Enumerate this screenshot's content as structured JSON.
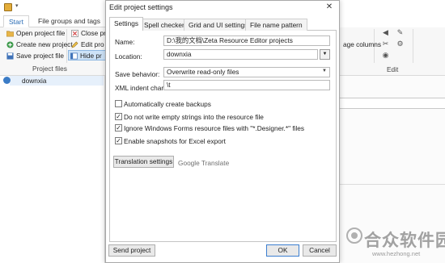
{
  "main_window": {
    "ribbon_tabs": [
      "Start",
      "File groups and tags"
    ],
    "qat_dropdown": "▾",
    "buttons": {
      "open_project_file": "Open project file",
      "create_new_project": "Create new project",
      "save_project_file": "Save project file",
      "close_project": "Close pr",
      "edit_project": "Edit pro",
      "hide_project": "Hide pr"
    },
    "group_label": "Project files",
    "tree_item": "downxia",
    "right_ribbon": {
      "columns_text": "age columns",
      "edit_group": "Edit"
    }
  },
  "dialog": {
    "title": "Edit project settings",
    "close_glyph": "✕",
    "tabs": [
      "Settings",
      "Spell checker",
      "Grid and UI settings",
      "File name pattern"
    ],
    "name_label": "Name:",
    "name_value": "D:\\我的文档\\Zeta Resource Editor projects",
    "location_label": "Location:",
    "location_value": "downxia",
    "location_btn": "▼",
    "save_behavior_label": "Save behavior:",
    "save_behavior_value": "Overwrite read-only files",
    "save_caret": "▼",
    "indent_label": "XML indent chars:",
    "indent_value": "\\t",
    "checkboxes": [
      {
        "label": "Automatically create backups",
        "mark": ""
      },
      {
        "label": "Do not write empty strings into the resource file",
        "mark": "✓"
      },
      {
        "label": "Ignore Windows Forms resource files with \"*.Designer.*\" files",
        "mark": "✓"
      },
      {
        "label": "Enable snapshots for Excel export",
        "mark": "✓"
      }
    ],
    "translation_settings_btn": "Translation settings",
    "google_translate": "Google Translate",
    "send_project_btn": "Send project",
    "ok_btn": "OK",
    "cancel_btn": "Cancel"
  },
  "watermark": {
    "text": "合众软件园",
    "url": "www.hezhong.net"
  },
  "colors": {
    "accent": "#2a6cb5",
    "selection": "#cde2f7",
    "ok_border": "#3c7fd0"
  }
}
